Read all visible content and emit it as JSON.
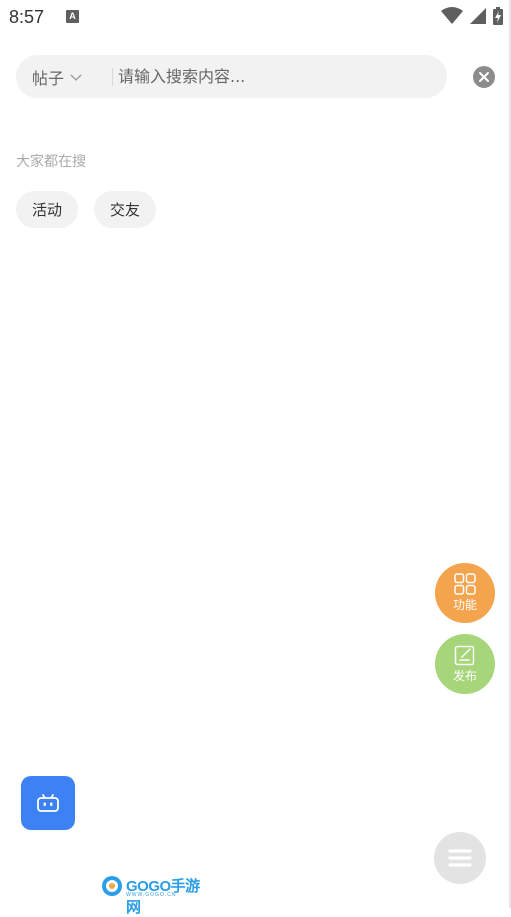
{
  "status_bar": {
    "time": "8:57",
    "notification_glyph": "A"
  },
  "search": {
    "scope_label": "帖子",
    "placeholder": "请输入搜索内容..."
  },
  "hot": {
    "title": "大家都在搜",
    "tags": [
      "活动",
      "交友"
    ]
  },
  "fab": {
    "functions_label": "功能",
    "publish_label": "发布"
  },
  "watermark": {
    "brand": "GOGO手游网",
    "sub": "WWW.GOGO.CN"
  },
  "colors": {
    "functions": "#f4a44c",
    "publish": "#a6d57a",
    "robot": "#3d82f5"
  },
  "icons": {
    "wifi": "wifi-icon",
    "signal": "signal-icon",
    "battery": "battery-charging-icon",
    "clear": "close-circle-icon",
    "functions": "grid-icon",
    "publish": "edit-icon",
    "robot": "robot-icon",
    "menu": "menu-icon"
  }
}
